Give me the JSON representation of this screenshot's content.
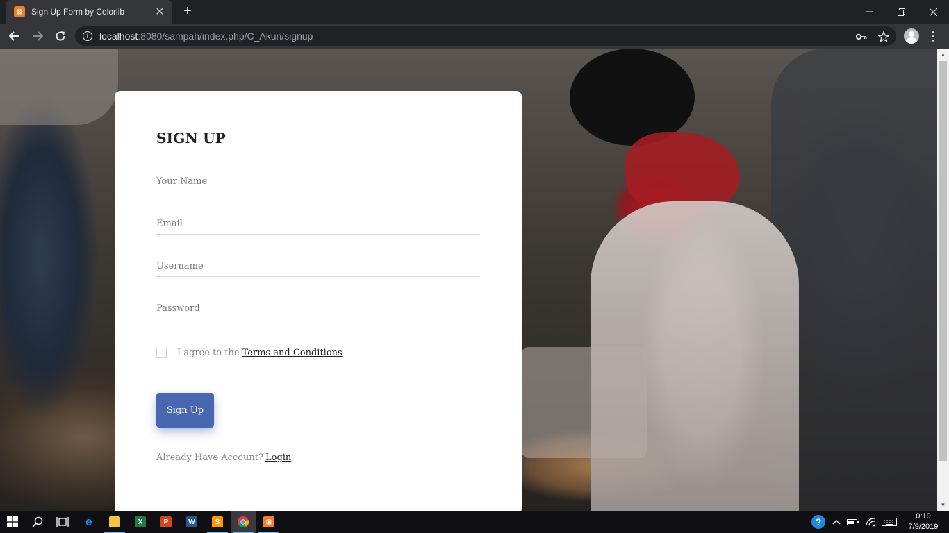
{
  "browser": {
    "tab_title": "Sign Up Form by Colorlib",
    "tab_favicon": "xampp-icon",
    "url_host": "localhost",
    "url_rest": ":8080/sampah/index.php/C_Akun/signup"
  },
  "form": {
    "title": "SIGN UP",
    "name_placeholder": "Your Name",
    "email_placeholder": "Email",
    "username_placeholder": "Username",
    "password_placeholder": "Password",
    "agree_text": "I agree to the",
    "terms_link": "Terms and Conditions",
    "submit_label": "Sign Up",
    "login_prompt": "Already Have Account?",
    "login_link": "Login",
    "accent_color": "#4966b0"
  },
  "taskbar": {
    "time": "0:19",
    "date": "7/9/2019",
    "apps": [
      "start",
      "search",
      "task-view",
      "edge",
      "file-explorer",
      "excel",
      "powerpoint",
      "word",
      "sublime-text",
      "chrome",
      "xampp"
    ]
  }
}
